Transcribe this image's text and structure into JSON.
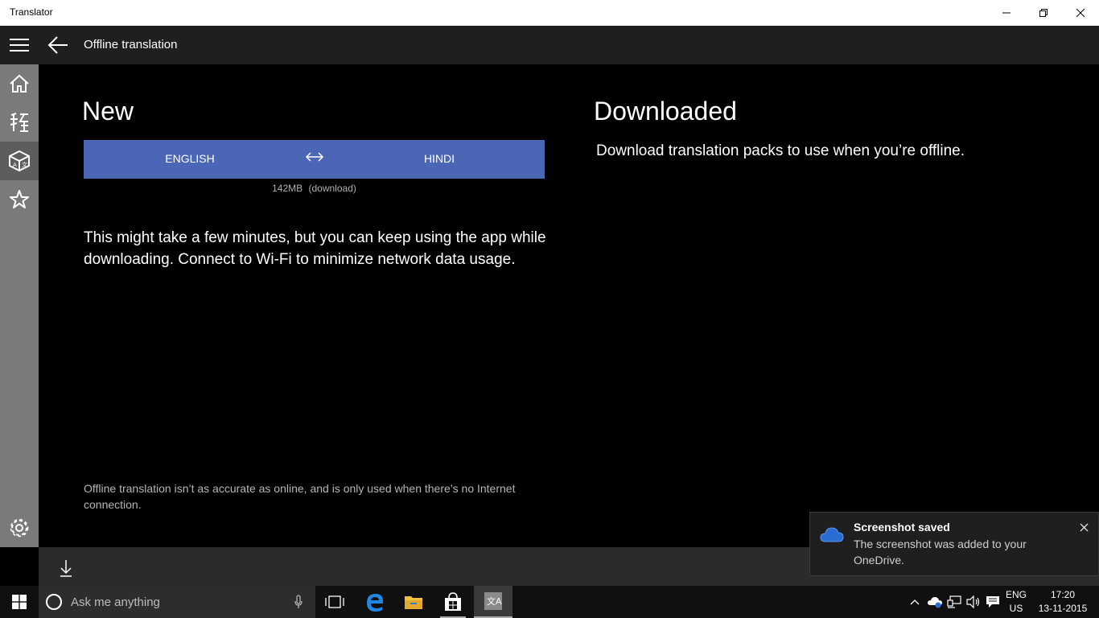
{
  "window": {
    "title": "Translator"
  },
  "header": {
    "page_title": "Offline translation"
  },
  "nav": {
    "items": [
      "menu-icon",
      "home-icon",
      "translate-icon",
      "offline-packs-icon",
      "favorites-icon",
      "settings-icon"
    ],
    "selected": "offline-packs-icon"
  },
  "new_section": {
    "heading": "New",
    "language_pack": {
      "source": "ENGLISH",
      "target": "HINDI",
      "swap_glyph": "↔",
      "size": "142MB",
      "action": "(download)"
    },
    "description": "This might take a few minutes, but you can keep using the app while downloading. Connect to Wi-Fi to minimize network data usage.",
    "note": "Offline translation isn’t as accurate as online, and is only used when there’s no Internet connection."
  },
  "downloaded_section": {
    "heading": "Downloaded",
    "description": "Download translation packs to use when you’re offline."
  },
  "toast": {
    "title": "Screenshot saved",
    "body": "The screenshot was added to your OneDrive.",
    "icon": "onedrive-cloud-icon"
  },
  "taskbar": {
    "search_placeholder": "Ask me anything",
    "language": "ENG",
    "region": "US",
    "time": "17:20",
    "date": "13-11-2015"
  },
  "colors": {
    "accent": "#4a66b5",
    "rail": "#7a7a7a",
    "header": "#1f1f1f"
  }
}
